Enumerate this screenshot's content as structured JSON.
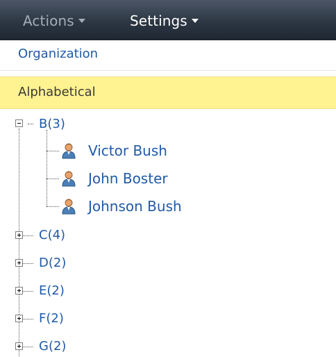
{
  "toolbar": {
    "actions_label": "Actions",
    "settings_label": "Settings"
  },
  "views": {
    "organization": "Organization",
    "alphabetical": "Alphabetical"
  },
  "tree": {
    "groups": [
      {
        "label": "B(3)",
        "expanded": true,
        "people": [
          "Victor Bush",
          "John Boster",
          "Johnson Bush"
        ]
      },
      {
        "label": "C(4)",
        "expanded": false
      },
      {
        "label": "D(2)",
        "expanded": false
      },
      {
        "label": "E(2)",
        "expanded": false
      },
      {
        "label": "F(2)",
        "expanded": false
      },
      {
        "label": "G(2)",
        "expanded": false
      }
    ]
  },
  "colors": {
    "toolbar_bg": "#2d3744",
    "link": "#1f5aa8",
    "selected_view_bg": "#fff290"
  },
  "icons": {
    "expander_expanded": "minus-box-icon",
    "expander_collapsed": "plus-box-icon",
    "person": "person-icon"
  }
}
